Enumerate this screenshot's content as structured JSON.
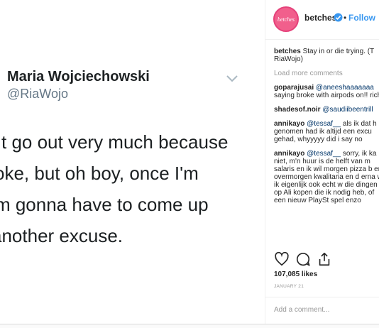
{
  "tweet": {
    "name": "Maria Wojciechowski",
    "handle": "@RiaWojo",
    "lines": [
      "t go out very much because",
      "oke, but oh boy, once I'm",
      "'m gonna have to come up",
      "another excuse."
    ]
  },
  "post": {
    "avatar_text": "betches",
    "username": "betches",
    "dot": "•",
    "follow_label": "Follow",
    "caption_user": "betches",
    "caption_text": "Stay in or die trying. (T",
    "caption_cont": "RiaWojo)",
    "load_more": "Load more comments",
    "comments": [
      {
        "user": "goparajusai",
        "mention": "@aneeshaaaaaaa",
        "text": "saying broke with airpods on!! rich"
      },
      {
        "user": "shadesof.noir",
        "mention": "@saudiibeentrill",
        "text": ""
      },
      {
        "user": "annikayo",
        "mention": "@tessaf__",
        "text": "als ik dat h genomen had ik altijd een excu gehad, whyyyyy did i say no"
      },
      {
        "user": "annikayo",
        "mention": "@tessaf__",
        "text": "sorry, ik ka niet, m'n huur is de helft van m salaris en ik wil morgen pizza b en overmorgen kwalitaria en d erna wil ik eigenlijk ook echt w die dingen op Ali kopen die ik nodig heb, of een nieuw PlaySt spel enzo"
      }
    ],
    "likes": "107,085 likes",
    "date": "JANUARY 21",
    "add_comment_placeholder": "Add a comment...",
    "accent_color": "#3897f0",
    "avatar_color": "#f15f8c"
  }
}
